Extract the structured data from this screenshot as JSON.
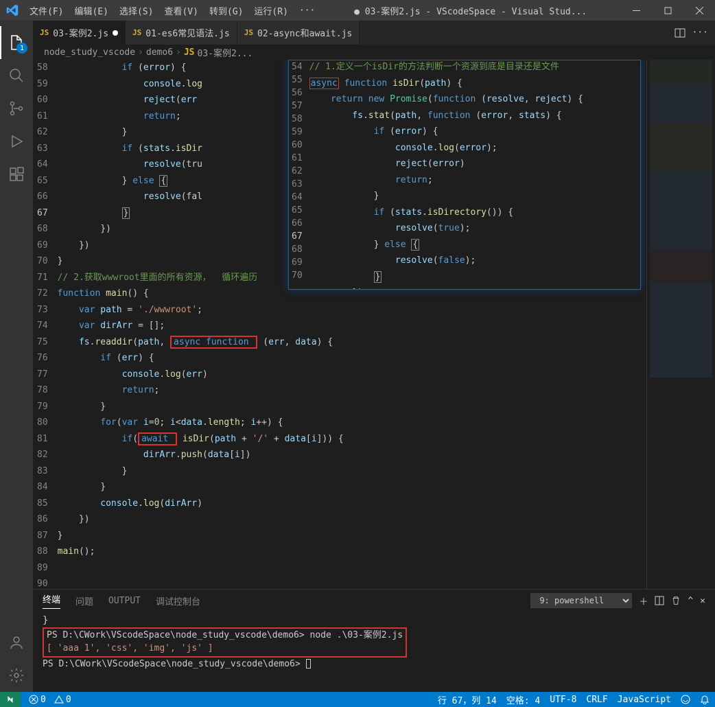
{
  "title": "● 03-案例2.js - VScodeSpace - Visual Stud...",
  "menu": [
    "文件(F)",
    "编辑(E)",
    "选择(S)",
    "查看(V)",
    "转到(G)",
    "运行(R)",
    "···"
  ],
  "activity_badge": "1",
  "tabs": [
    {
      "icon": "JS",
      "label": "03-案例2.js",
      "modified": true,
      "active": true
    },
    {
      "icon": "JS",
      "label": "01-es6常见语法.js",
      "modified": false,
      "active": false
    },
    {
      "icon": "JS",
      "label": "02-async和await.js",
      "modified": false,
      "active": false
    }
  ],
  "breadcrumb": [
    "node_study_vscode",
    "demo6",
    "03-案例2..."
  ],
  "main_lines_start": 58,
  "main_lines_end": 90,
  "main_hl_line": 67,
  "main_code": [
    "            if (error) {",
    "                console.log",
    "                reject(err",
    "                return;",
    "            }",
    "            if (stats.isDir",
    "                resolve(tru",
    "            } else {",
    "                resolve(fal",
    "            }",
    "        })",
    "    })",
    "}",
    "// 2.获取wwwroot里面的所有资源，  循环遍历",
    "function main() {",
    "    var path = './wwwroot';",
    "    var dirArr = [];",
    "    fs.readdir(path, async function (err, data) {",
    "        if (err) {",
    "            console.log(err)",
    "            return;",
    "        }",
    "        for(var i=0; i<data.length; i++) {",
    "            if(await isDir(path + '/' + data[i])) {",
    "                dirArr.push(data[i])",
    "            }",
    "        }",
    "        console.log(dirArr)",
    "    })",
    "}",
    "main();",
    "",
    ""
  ],
  "float_lines_start": 54,
  "float_lines_end": 70,
  "float_hl_line": 67,
  "float_code": [
    "// 1.定义一个isDir的方法判断一个资源到底是目录还是文件",
    "async function isDir(path) {",
    "    return new Promise(function (resolve, reject) {",
    "        fs.stat(path, function (error, stats) {",
    "            if (error) {",
    "                console.log(error);",
    "                reject(error)",
    "                return;",
    "            }",
    "            if (stats.isDirectory()) {",
    "                resolve(true);",
    "            } else {",
    "                resolve(false);",
    "            }",
    "        })",
    "    })",
    "}"
  ],
  "panel_tabs": [
    "终端",
    "问题",
    "OUTPUT",
    "调试控制台"
  ],
  "panel_active": 0,
  "panel_select": "9: powershell",
  "terminal": {
    "line0": "}",
    "prompt1": "PS D:\\CWork\\VScodeSpace\\node_study_vscode\\demo6>",
    "cmd1": "node .\\03-案例2.js",
    "out1": "[ 'aaa 1', 'css', 'img', 'js' ]",
    "prompt2": "PS D:\\CWork\\VScodeSpace\\node_study_vscode\\demo6>"
  },
  "status": {
    "errors": "0",
    "warnings": "0",
    "pos": "行 67，列 14",
    "spaces": "空格: 4",
    "enc": "UTF-8",
    "eol": "CRLF",
    "lang": "JavaScript"
  }
}
